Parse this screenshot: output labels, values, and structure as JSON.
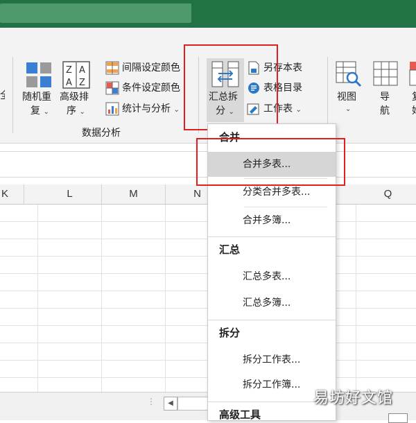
{
  "ribbon": {
    "edge_left_char": "全",
    "random_line1": "随机重",
    "random_line2": "复",
    "adv_sort_line1": "高级排",
    "adv_sort_line2": "序",
    "interval_color": "间隔设定颜色",
    "cond_color": "条件设定颜色",
    "stats_analysis": "统计与分析",
    "group_label": "数据分析",
    "summarize_line1": "汇总拆",
    "summarize_line2": "分",
    "save_as_table": "另存本表",
    "table_directory": "表格目录",
    "worksheet": "工作表",
    "view": "视图",
    "nav_line1": "导",
    "nav_line2": "航",
    "edge_right_line1": "复",
    "edge_right_line2": "始"
  },
  "columns": [
    "K",
    "L",
    "M",
    "N",
    "Q"
  ],
  "dropdown": {
    "sections": [
      {
        "header": "合并",
        "items": [
          "合并多表...",
          "分类合并多表...",
          "合并多簿..."
        ]
      },
      {
        "header": "汇总",
        "items": [
          "汇总多表...",
          "汇总多簿..."
        ]
      },
      {
        "header": "拆分",
        "items": [
          "拆分工作表...",
          "拆分工作簿..."
        ]
      },
      {
        "header": "高级工具",
        "items": []
      }
    ],
    "highlighted_item": "合并多表..."
  },
  "colors": {
    "title_bar": "#217346",
    "highlight_border": "#e02020",
    "hover_item": "#d6d6d6"
  },
  "watermark": "易坊好文馆"
}
